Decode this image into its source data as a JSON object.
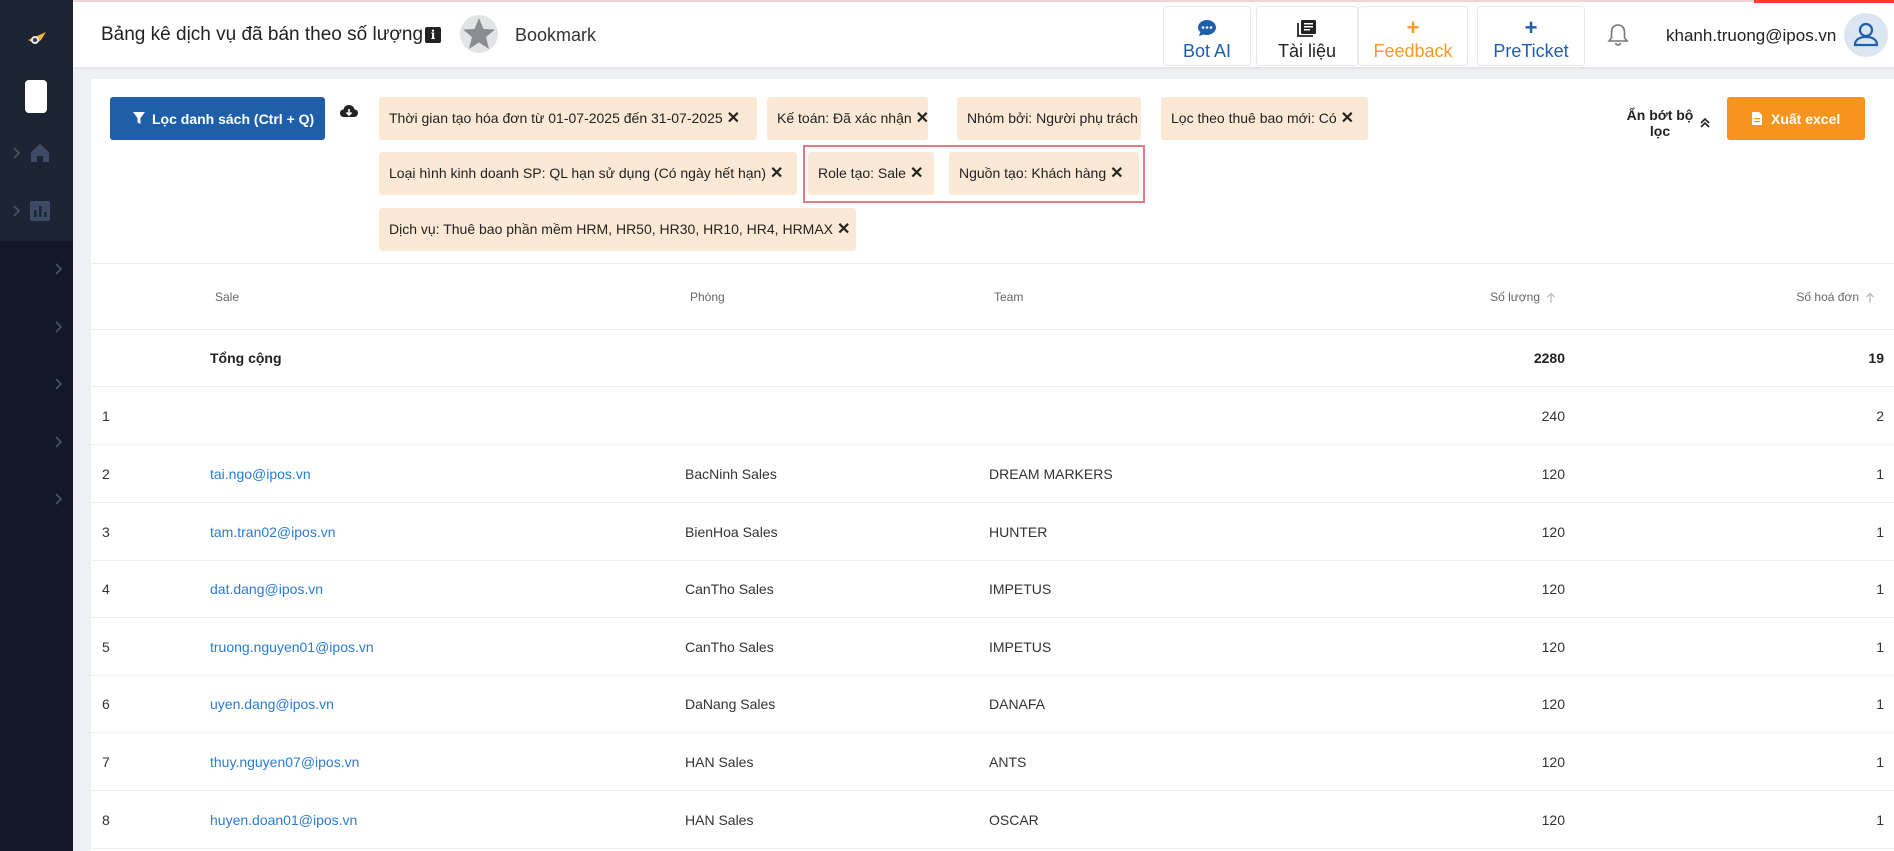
{
  "header": {
    "page_title": "Bảng kê dịch vụ đã bán theo số lượng",
    "bookmark_label": "Bookmark",
    "buttons": {
      "bot_ai": "Bot AI",
      "docs": "Tài liệu",
      "feedback": "Feedback",
      "preticket": "PreTicket"
    },
    "user_email": "khanh.truong@ipos.vn"
  },
  "toolbar": {
    "filter_button": "Lọc danh sách (Ctrl + Q)",
    "collapse_filters": "Ẩn bớt bộ lọc",
    "export_button": "Xuất excel"
  },
  "filters": [
    {
      "label": "Thời gian tạo hóa đơn từ 01-07-2025 đến 31-07-2025"
    },
    {
      "label": "Kế toán: Đã xác nhận"
    },
    {
      "label": "Nhóm bởi: Người phụ trách"
    },
    {
      "label": "Lọc theo thuê bao mới: Có"
    },
    {
      "label": "Loại hình kinh doanh SP: QL hạn sử dụng (Có ngày hết hạn)"
    },
    {
      "label": "Role tạo: Sale"
    },
    {
      "label": "Nguồn tạo: Khách hàng"
    },
    {
      "label": "Dịch vụ: Thuê bao phần mềm HRM, HR50, HR30, HR10, HR4, HRMAX"
    }
  ],
  "table": {
    "columns": {
      "sale": "Sale",
      "phong": "Phòng",
      "team": "Team",
      "qty": "Số lượng",
      "invoices": "Số hoá đơn"
    },
    "total": {
      "label": "Tổng cộng",
      "qty": "2280",
      "invoices": "19"
    },
    "rows": [
      {
        "idx": "1",
        "sale": "",
        "phong": "",
        "team": "",
        "qty": "240",
        "invoices": "2"
      },
      {
        "idx": "2",
        "sale": "tai.ngo@ipos.vn",
        "phong": "BacNinh Sales",
        "team": "DREAM MARKERS",
        "qty": "120",
        "invoices": "1"
      },
      {
        "idx": "3",
        "sale": "tam.tran02@ipos.vn",
        "phong": "BienHoa Sales",
        "team": "HUNTER",
        "qty": "120",
        "invoices": "1"
      },
      {
        "idx": "4",
        "sale": "dat.dang@ipos.vn",
        "phong": "CanTho Sales",
        "team": "IMPETUS",
        "qty": "120",
        "invoices": "1"
      },
      {
        "idx": "5",
        "sale": "truong.nguyen01@ipos.vn",
        "phong": "CanTho Sales",
        "team": "IMPETUS",
        "qty": "120",
        "invoices": "1"
      },
      {
        "idx": "6",
        "sale": "uyen.dang@ipos.vn",
        "phong": "DaNang Sales",
        "team": "DANAFA",
        "qty": "120",
        "invoices": "1"
      },
      {
        "idx": "7",
        "sale": "thuy.nguyen07@ipos.vn",
        "phong": "HAN Sales",
        "team": "ANTS",
        "qty": "120",
        "invoices": "1"
      },
      {
        "idx": "8",
        "sale": "huyen.doan01@ipos.vn",
        "phong": "HAN Sales",
        "team": "OSCAR",
        "qty": "120",
        "invoices": "1"
      }
    ]
  },
  "colors": {
    "primary": "#1f5fa9",
    "accent_orange": "#f7941d",
    "chip_bg": "#fbe9d6",
    "link": "#2a7cd3",
    "sidebar": "#121826",
    "highlight_border": "#e57a80"
  },
  "icons": [
    "logo-icon",
    "home-icon",
    "chart-icon",
    "info-icon",
    "star-icon",
    "chat-icon",
    "book-icon",
    "plus-icon",
    "bell-icon",
    "user-icon",
    "filter-icon",
    "cloud-download-icon",
    "close-icon",
    "double-chevron-up-icon",
    "file-icon",
    "sort-arrow-icon"
  ]
}
